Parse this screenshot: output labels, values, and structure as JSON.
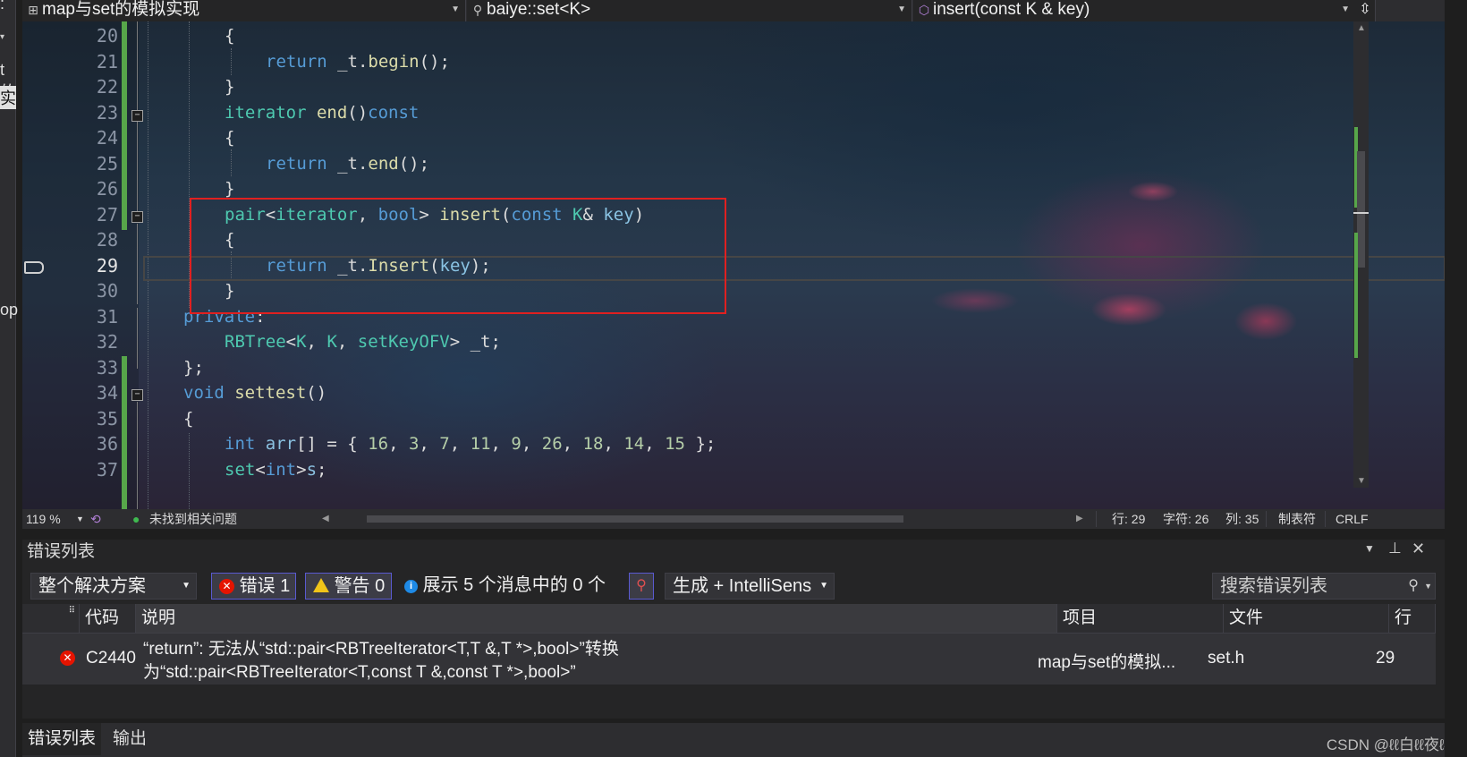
{
  "left_strip": {
    "fragments": [
      ":",
      "t的",
      "实",
      "op"
    ]
  },
  "nav": {
    "project_dropdown": "map与set的模拟实现",
    "scope_dropdown": "baiye::set<K>",
    "member_dropdown": "insert(const K & key)",
    "split_icon": "split-icon"
  },
  "editor": {
    "lines": [
      {
        "num": "20",
        "tokens": [
          {
            "t": "{",
            "c": "pl"
          }
        ],
        "indent": 2
      },
      {
        "num": "21",
        "tokens": [
          {
            "t": "return",
            "c": "kw"
          },
          {
            "t": " _t.",
            "c": "pl"
          },
          {
            "t": "begin",
            "c": "fn"
          },
          {
            "t": "();",
            "c": "pl"
          }
        ],
        "indent": 3
      },
      {
        "num": "22",
        "tokens": [
          {
            "t": "}",
            "c": "pl"
          }
        ],
        "indent": 2
      },
      {
        "num": "23",
        "tokens": [
          {
            "t": "iterator ",
            "c": "ty"
          },
          {
            "t": "end",
            "c": "fn"
          },
          {
            "t": "()",
            "c": "pl"
          },
          {
            "t": "const",
            "c": "kw"
          }
        ],
        "indent": 2
      },
      {
        "num": "24",
        "tokens": [
          {
            "t": "{",
            "c": "pl"
          }
        ],
        "indent": 2
      },
      {
        "num": "25",
        "tokens": [
          {
            "t": "return",
            "c": "kw"
          },
          {
            "t": " _t.",
            "c": "pl"
          },
          {
            "t": "end",
            "c": "fn"
          },
          {
            "t": "();",
            "c": "pl"
          }
        ],
        "indent": 3
      },
      {
        "num": "26",
        "tokens": [
          {
            "t": "}",
            "c": "pl"
          }
        ],
        "indent": 2
      },
      {
        "num": "27",
        "tokens": [
          {
            "t": "pair",
            "c": "ty"
          },
          {
            "t": "<",
            "c": "pl"
          },
          {
            "t": "iterator",
            "c": "ty"
          },
          {
            "t": ", ",
            "c": "pl"
          },
          {
            "t": "bool",
            "c": "kw"
          },
          {
            "t": "> ",
            "c": "pl"
          },
          {
            "t": "insert",
            "c": "fn"
          },
          {
            "t": "(",
            "c": "pl"
          },
          {
            "t": "const ",
            "c": "kw"
          },
          {
            "t": "K",
            "c": "ty"
          },
          {
            "t": "& ",
            "c": "pl"
          },
          {
            "t": "key",
            "c": "par"
          },
          {
            "t": ")",
            "c": "pl"
          }
        ],
        "indent": 2
      },
      {
        "num": "28",
        "tokens": [
          {
            "t": "{",
            "c": "pl"
          }
        ],
        "indent": 2
      },
      {
        "num": "29",
        "tokens": [
          {
            "t": "return",
            "c": "kw"
          },
          {
            "t": " _t.",
            "c": "pl"
          },
          {
            "t": "Insert",
            "c": "fn"
          },
          {
            "t": "(",
            "c": "pl"
          },
          {
            "t": "key",
            "c": "par"
          },
          {
            "t": ");",
            "c": "pl"
          }
        ],
        "indent": 3
      },
      {
        "num": "30",
        "tokens": [
          {
            "t": "}",
            "c": "pl"
          }
        ],
        "indent": 2
      },
      {
        "num": "31",
        "tokens": [
          {
            "t": "private",
            "c": "kw"
          },
          {
            "t": ":",
            "c": "pl"
          }
        ],
        "indent": 1
      },
      {
        "num": "32",
        "tokens": [
          {
            "t": "RBTree",
            "c": "ty"
          },
          {
            "t": "<",
            "c": "pl"
          },
          {
            "t": "K",
            "c": "ty"
          },
          {
            "t": ", ",
            "c": "pl"
          },
          {
            "t": "K",
            "c": "ty"
          },
          {
            "t": ", ",
            "c": "pl"
          },
          {
            "t": "setKeyOFV",
            "c": "ty"
          },
          {
            "t": "> _t;",
            "c": "pl"
          }
        ],
        "indent": 2
      },
      {
        "num": "33",
        "tokens": [
          {
            "t": "};",
            "c": "pl"
          }
        ],
        "indent": 1
      },
      {
        "num": "34",
        "tokens": [
          {
            "t": "void ",
            "c": "kw"
          },
          {
            "t": "settest",
            "c": "fn"
          },
          {
            "t": "()",
            "c": "pl"
          }
        ],
        "indent": 1
      },
      {
        "num": "35",
        "tokens": [
          {
            "t": "{",
            "c": "pl"
          }
        ],
        "indent": 1
      },
      {
        "num": "36",
        "tokens": [
          {
            "t": "int ",
            "c": "kw"
          },
          {
            "t": "arr",
            "c": "par"
          },
          {
            "t": "[] = { ",
            "c": "pl"
          },
          {
            "t": "16",
            "c": "num"
          },
          {
            "t": ", ",
            "c": "pl"
          },
          {
            "t": "3",
            "c": "num"
          },
          {
            "t": ", ",
            "c": "pl"
          },
          {
            "t": "7",
            "c": "num"
          },
          {
            "t": ", ",
            "c": "pl"
          },
          {
            "t": "11",
            "c": "num"
          },
          {
            "t": ", ",
            "c": "pl"
          },
          {
            "t": "9",
            "c": "num"
          },
          {
            "t": ", ",
            "c": "pl"
          },
          {
            "t": "26",
            "c": "num"
          },
          {
            "t": ", ",
            "c": "pl"
          },
          {
            "t": "18",
            "c": "num"
          },
          {
            "t": ", ",
            "c": "pl"
          },
          {
            "t": "14",
            "c": "num"
          },
          {
            "t": ", ",
            "c": "pl"
          },
          {
            "t": "15",
            "c": "num"
          },
          {
            "t": " };",
            "c": "pl"
          }
        ],
        "indent": 2
      },
      {
        "num": "37",
        "tokens": [
          {
            "t": "set",
            "c": "ty"
          },
          {
            "t": "<",
            "c": "pl"
          },
          {
            "t": "int",
            "c": "kw"
          },
          {
            "t": ">",
            "c": "pl"
          },
          {
            "t": "s",
            "c": "par"
          },
          {
            "t": ";",
            "c": "pl"
          }
        ],
        "indent": 2
      }
    ],
    "current_line": "29"
  },
  "editor_status": {
    "zoom": "119 %",
    "issues": "未找到相关问题",
    "line": "行: 29",
    "char": "字符: 26",
    "col": "列: 35",
    "tabs": "制表符",
    "eol": "CRLF"
  },
  "error_list": {
    "title": "错误列表",
    "scope": "整个解决方案",
    "errors_btn": "错误 1",
    "warnings_btn": "警告 0",
    "messages": "展示 5 个消息中的 0 个",
    "build_filter": "生成 + IntelliSens",
    "search_placeholder": "搜索错误列表",
    "columns": {
      "code": "代码",
      "desc": "说明",
      "project": "项目",
      "file": "文件",
      "line": "行"
    },
    "rows": [
      {
        "code": "C2440",
        "desc_line1": "“return”: 无法从“std::pair<RBTreeIterator<T,T &,T *>,bool>”转换",
        "desc_line2": "为“std::pair<RBTreeIterator<T,const T &,const T *>,bool>”",
        "project": "map与set的模拟...",
        "file": "set.h",
        "line": "29"
      }
    ]
  },
  "bottom_tabs": {
    "errors": "错误列表",
    "output": "输出"
  },
  "watermark": "CSDN @ℓℓ白ℓℓ夜ℓℓ",
  "colors": {
    "error": "#e51400",
    "warning": "#f0c419",
    "info": "#1e8ae6",
    "change_bar": "#57a64a",
    "highlight_box": "#e02020"
  }
}
